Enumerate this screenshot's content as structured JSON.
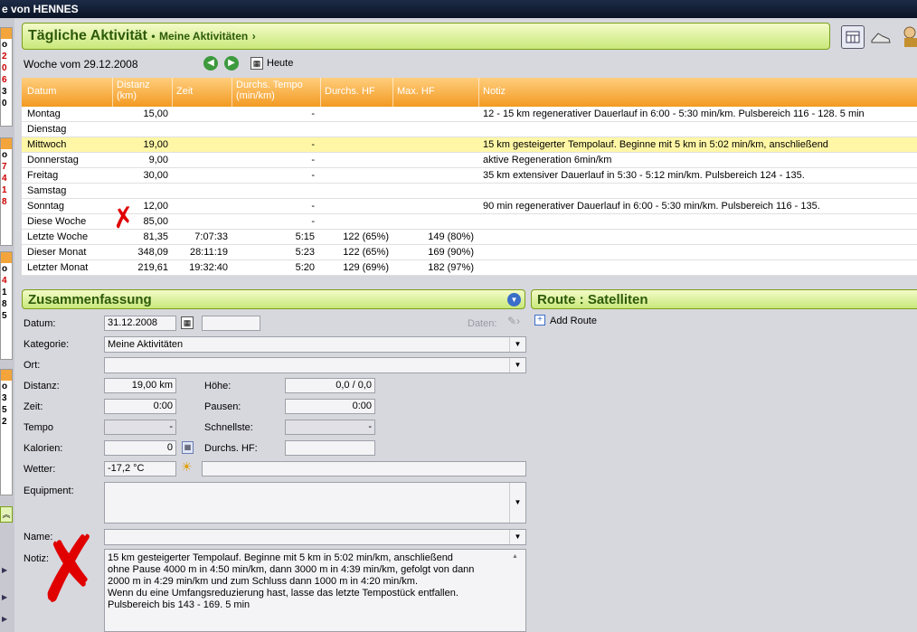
{
  "window": {
    "title": "e von HENNES"
  },
  "leftstrip": {
    "group1": [
      "o",
      "2",
      "0",
      "6",
      "3",
      "0"
    ],
    "group2": [
      "o",
      "7",
      "4",
      "1",
      "8"
    ],
    "group3": [
      "o",
      "4",
      "1",
      "8",
      "5"
    ],
    "group4": [
      "o",
      "3",
      "5",
      "2"
    ]
  },
  "header": {
    "title": "Tägliche Aktivität",
    "bullet": "•",
    "subtitle": "Meine Aktivitäten",
    "chevron": "›"
  },
  "week": {
    "label": "Woche vom 29.12.2008",
    "today_label": "Heute"
  },
  "table": {
    "columns": [
      "Datum",
      "Distanz\n(km)",
      "Zeit",
      "Durchs. Tempo\n(min/km)",
      "Durchs. HF",
      "Max. HF",
      "Notiz"
    ],
    "rows": [
      {
        "datum": "Montag",
        "distanz": "15,00",
        "zeit": "",
        "tempo": "-",
        "hf": "",
        "maxhf": "",
        "notiz": "12 - 15 km regenerativer Dauerlauf in 6:00 - 5:30  min/km. Pulsbereich 116 - 128. 5 min"
      },
      {
        "datum": "Dienstag",
        "distanz": "",
        "zeit": "",
        "tempo": "",
        "hf": "",
        "maxhf": "",
        "notiz": ""
      },
      {
        "datum": "Mittwoch",
        "distanz": "19,00",
        "zeit": "",
        "tempo": "-",
        "hf": "",
        "maxhf": "",
        "notiz": "15 km gesteigerter Tempolauf. Beginne mit 5 km in 5:02 min/km, anschließend",
        "selected": true
      },
      {
        "datum": "Donnerstag",
        "distanz": "9,00",
        "zeit": "",
        "tempo": "-",
        "hf": "",
        "maxhf": "",
        "notiz": "aktive Regeneration 6min/km"
      },
      {
        "datum": "Freitag",
        "distanz": "30,00",
        "zeit": "",
        "tempo": "-",
        "hf": "",
        "maxhf": "",
        "notiz": "35 km extensiver Dauerlauf in 5:30 - 5:12  min/km. Pulsbereich 124 - 135."
      },
      {
        "datum": "Samstag",
        "distanz": "",
        "zeit": "",
        "tempo": "",
        "hf": "",
        "maxhf": "",
        "notiz": ""
      },
      {
        "datum": "Sonntag",
        "distanz": "12,00",
        "zeit": "",
        "tempo": "-",
        "hf": "",
        "maxhf": "",
        "notiz": "90 min regenerativer Dauerlauf in 6:00 - 5:30 min/km. Pulsbereich 116 - 135."
      }
    ],
    "summary": [
      {
        "datum": "Diese Woche",
        "distanz": "85,00",
        "zeit": "",
        "tempo": "-",
        "hf": "",
        "maxhf": ""
      },
      {
        "datum": "Letzte Woche",
        "distanz": "81,35",
        "zeit": "7:07:33",
        "tempo": "5:15",
        "hf": "122 (65%)",
        "maxhf": "149 (80%)"
      },
      {
        "datum": "Dieser Monat",
        "distanz": "348,09",
        "zeit": "28:11:19",
        "tempo": "5:23",
        "hf": "122 (65%)",
        "maxhf": "169 (90%)"
      },
      {
        "datum": "Letzter Monat",
        "distanz": "219,61",
        "zeit": "19:32:40",
        "tempo": "5:20",
        "hf": "129 (69%)",
        "maxhf": "182 (97%)"
      }
    ]
  },
  "summary_panel": {
    "title": "Zusammenfassung",
    "datum_label": "Datum:",
    "datum_value": "31.12.2008",
    "daten_label": "Daten:",
    "kategorie_label": "Kategorie:",
    "kategorie_value": "Meine Aktivitäten",
    "ort_label": "Ort:",
    "ort_value": "",
    "distanz_label": "Distanz:",
    "distanz_value": "19,00 km",
    "hoehe_label": "Höhe:",
    "hoehe_value": "0,0 / 0,0",
    "zeit_label": "Zeit:",
    "zeit_value": "0:00",
    "pausen_label": "Pausen:",
    "pausen_value": "0:00",
    "tempo_label": "Tempo",
    "tempo_value": "-",
    "schnellste_label": "Schnellste:",
    "schnellste_value": "-",
    "kalorien_label": "Kalorien:",
    "kalorien_value": "0",
    "hf_label": "Durchs. HF:",
    "hf_value": "",
    "wetter_label": "Wetter:",
    "wetter_value": "-17,2 °C",
    "equipment_label": "Equipment:",
    "name_label": "Name:",
    "name_value": "",
    "notiz_label": "Notiz:",
    "notiz_value": "15 km gesteigerter Tempolauf. Beginne mit 5 km in 5:02 min/km, anschließend\nohne Pause 4000 m in 4:50 min/km, dann 3000 m in 4:39 min/km, gefolgt von dann\n2000 m in 4:29 min/km und zum Schluss dann 1000 m in 4:20 min/km.\nWenn du eine Umfangsreduzierung hast, lasse das letzte Tempostück entfallen.\nPulsbereich bis 143 - 169. 5 min"
  },
  "route_panel": {
    "title": "Route : Satelliten",
    "add_label": "Add Route"
  },
  "annotations": {
    "mark_small": "✗",
    "mark_large": "✗"
  },
  "colors": {
    "accent_green": "#2d5a0a",
    "table_header": "#f39a22",
    "selected_row": "#fff7a6",
    "annotation_red": "#e00000"
  }
}
